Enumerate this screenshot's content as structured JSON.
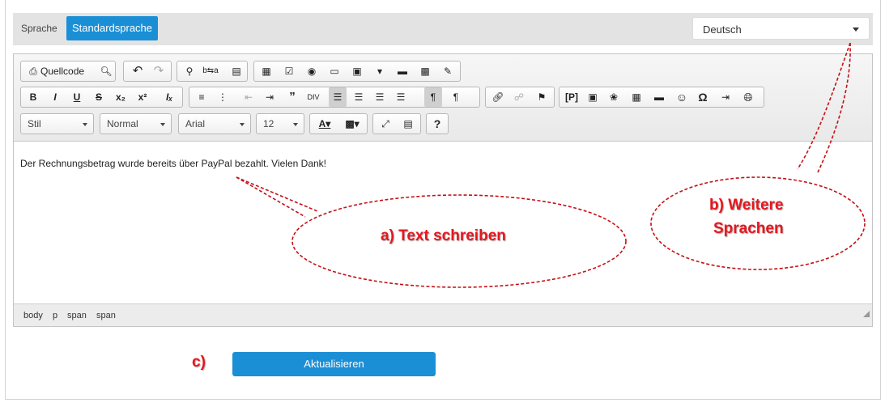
{
  "language": {
    "label": "Sprache",
    "active_tab": "Standardsprache",
    "select_value": "Deutsch"
  },
  "toolbar": {
    "row1": {
      "source_label": "Quellcode"
    },
    "row3": {
      "style_combo": "Stil",
      "format_combo": "Normal",
      "font_combo": "Arial",
      "size_combo": "12",
      "help": "?"
    }
  },
  "editor": {
    "content_text": "Der Rechnungsbetrag wurde bereits über PayPal bezahlt. Vielen Dank!",
    "path": [
      "body",
      "p",
      "span",
      "span"
    ]
  },
  "actions": {
    "update_label": "Aktualisieren"
  },
  "annotations": {
    "a": "a) Text schreiben",
    "b_line1": "b) Weitere",
    "b_line2": "Sprachen",
    "c": "c)"
  },
  "colors": {
    "accent": "#1b8fd6",
    "annotation": "#e8161d"
  }
}
